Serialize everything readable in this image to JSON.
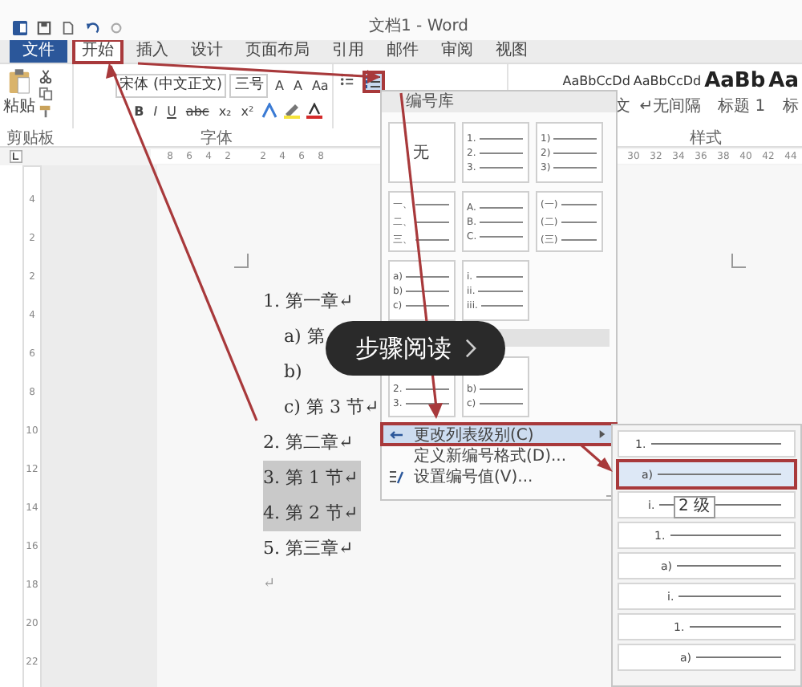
{
  "title_bar": {
    "title": "文档1 - Word"
  },
  "tabs": [
    {
      "label": "文件",
      "kind": "file",
      "selected": false,
      "annotated": false
    },
    {
      "label": "开始",
      "kind": "tab",
      "selected": true,
      "annotated": true
    },
    {
      "label": "插入",
      "kind": "tab",
      "selected": false,
      "annotated": false
    },
    {
      "label": "设计",
      "kind": "tab",
      "selected": false,
      "annotated": false
    },
    {
      "label": "页面布局",
      "kind": "tab",
      "selected": false,
      "annotated": false
    },
    {
      "label": "引用",
      "kind": "tab",
      "selected": false,
      "annotated": false
    },
    {
      "label": "邮件",
      "kind": "tab",
      "selected": false,
      "annotated": false
    },
    {
      "label": "审阅",
      "kind": "tab",
      "selected": false,
      "annotated": false
    },
    {
      "label": "视图",
      "kind": "tab",
      "selected": false,
      "annotated": false
    }
  ],
  "ribbon": {
    "paste_label": "粘贴",
    "font_name": "宋体 (中文正文)",
    "font_size": "三号",
    "font_buttons": [
      "A",
      "A",
      "Aa"
    ],
    "format_buttons": [
      "B",
      "I",
      "U",
      "abc",
      "x₂",
      "x²"
    ],
    "numbering_button": {
      "annotated": true
    },
    "styles": [
      {
        "sample": "AaBbCcDd",
        "name": "文",
        "kind": "normal"
      },
      {
        "sample": "AaBbCcDd",
        "name": "↵无间隔",
        "kind": "normal"
      },
      {
        "sample": "AaBb",
        "name": "标题 1",
        "kind": "heading"
      },
      {
        "sample": "Aa",
        "name": "标",
        "kind": "heading"
      }
    ],
    "group_labels": [
      "剪贴板",
      "字体",
      "样式"
    ]
  },
  "ruler": {
    "left_ticks": [
      "8",
      "6",
      "4",
      "2"
    ],
    "right_ticks": [
      "2",
      "4",
      "6",
      "8"
    ],
    "far_ticks": [
      "30",
      "32",
      "34",
      "36",
      "38",
      "40",
      "42",
      "44"
    ],
    "vertical_ticks": [
      "4",
      "2",
      "2",
      "4",
      "6",
      "8",
      "10",
      "12",
      "14",
      "16",
      "18",
      "20",
      "22"
    ]
  },
  "document": {
    "items": [
      {
        "number": "1.",
        "text": "第一章↵",
        "selected": false,
        "children": [
          {
            "number": "a)",
            "text": "第",
            "selected": false
          },
          {
            "number": "b)",
            "selected": false
          },
          {
            "number": "c)",
            "text": "第 3 节↵",
            "selected": false
          }
        ]
      },
      {
        "number": "2.",
        "text": "第二章↵",
        "selected": false
      },
      {
        "number": "3.",
        "text": "第 1 节↵",
        "selected": true
      },
      {
        "number": "4.",
        "text": "第 2 节↵",
        "selected": true
      },
      {
        "number": "5.",
        "text": "第三章↵",
        "selected": false
      }
    ],
    "end_mark": "↵"
  },
  "numbering_menu": {
    "header": "编号库",
    "library": [
      {
        "kind": "none",
        "label": "无"
      },
      {
        "kind": "list",
        "lines": [
          "1.",
          "2.",
          "3."
        ]
      },
      {
        "kind": "list",
        "lines": [
          "1)",
          "2)",
          "3)"
        ]
      },
      {
        "kind": "list",
        "lines": [
          "一、",
          "二、",
          "三、"
        ]
      },
      {
        "kind": "list",
        "lines": [
          "A.",
          "B.",
          "C."
        ]
      },
      {
        "kind": "list",
        "lines": [
          "(一)",
          "(二)",
          "(三)"
        ]
      },
      {
        "kind": "list",
        "lines": [
          "a)",
          "b)",
          "c)"
        ]
      },
      {
        "kind": "list",
        "lines": [
          "i.",
          "ii.",
          "iii."
        ]
      }
    ],
    "document_formats": [
      {
        "kind": "list",
        "lines": [
          "2.",
          "3."
        ]
      },
      {
        "kind": "list",
        "lines": [
          "b)",
          "c)"
        ]
      }
    ],
    "items": [
      {
        "label": "更改列表级别(C)",
        "kind": "submenu",
        "selected": true,
        "annotated": true
      },
      {
        "label": "定义新编号格式(D)...",
        "kind": "plain",
        "selected": false,
        "annotated": false
      },
      {
        "label": "设置编号值(V)...",
        "kind": "value",
        "selected": false,
        "annotated": false
      }
    ]
  },
  "level_menu": {
    "levels": [
      {
        "number": "1.",
        "selected": false,
        "annotated": false
      },
      {
        "number": "a)",
        "selected": true,
        "annotated": true
      },
      {
        "number": "i.",
        "selected": false,
        "annotated": false
      },
      {
        "number": "1.",
        "selected": false,
        "annotated": false
      },
      {
        "number": "a)",
        "selected": false,
        "annotated": false
      },
      {
        "number": "i.",
        "selected": false,
        "annotated": false
      },
      {
        "number": "1.",
        "selected": false,
        "annotated": false
      },
      {
        "number": "a)",
        "selected": false,
        "annotated": false
      }
    ],
    "tooltip": "2 级"
  },
  "overlay": {
    "label": "步骤阅读"
  }
}
